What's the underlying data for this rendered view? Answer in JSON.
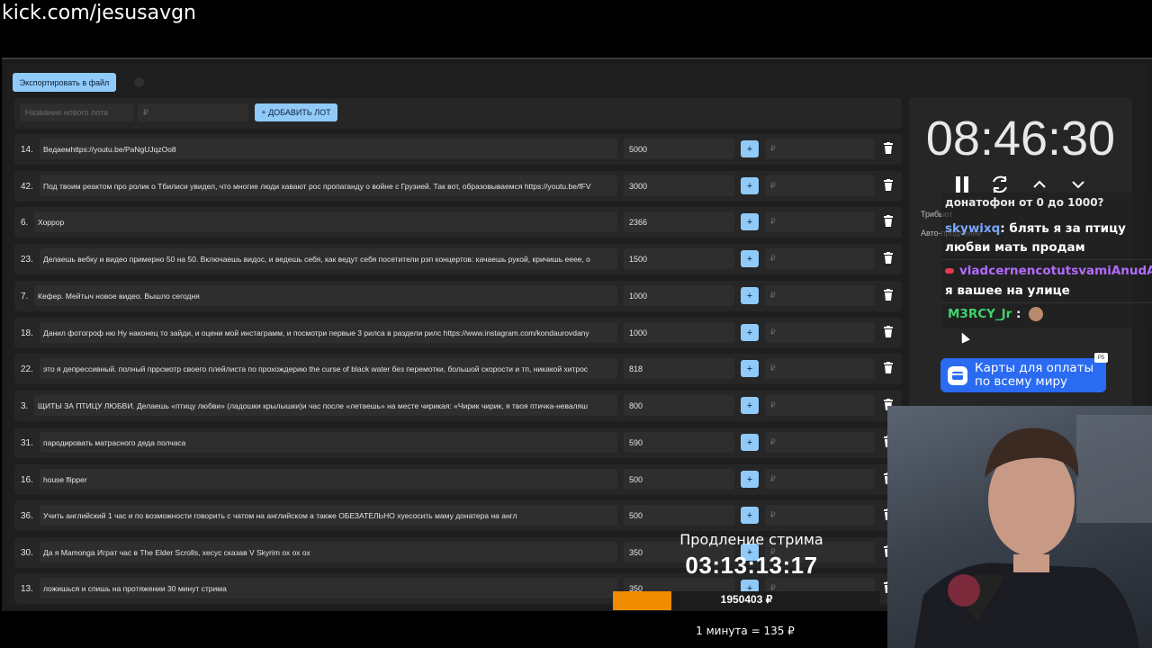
{
  "browser": {
    "url": "kick.com/jesusavgn"
  },
  "toolbar": {
    "export_label": "Экспортировать в файл"
  },
  "add_lot": {
    "name_placeholder": "Название нового лота",
    "amount_placeholder": "₽",
    "add_label": "+ ДОБАВИТЬ ЛОТ"
  },
  "lots": [
    {
      "num": "14.",
      "name": "Ведаемhttps://youtu.be/PaNgUJqzOo8",
      "amount": "5000",
      "plus": "+",
      "rub": "₽"
    },
    {
      "num": "42.",
      "name": "Под твоим реактом про ролик о Тбилиси увидел, что многие люди хавают рос пропаганду о войне с Грузией. Так вот, образовываемся https://youtu.be/fFV",
      "amount": "3000",
      "plus": "+",
      "rub": "₽"
    },
    {
      "num": "6.",
      "name": "Хоррор",
      "amount": "2366",
      "plus": "+",
      "rub": "₽"
    },
    {
      "num": "23.",
      "name": "Делаешь вебку и видео примерно 50 на 50. Включаешь видос, и ведешь себя, как ведут себя посетители рэп концертов: качаешь рукой, кричишь ееее, о",
      "amount": "1500",
      "plus": "+",
      "rub": "₽"
    },
    {
      "num": "7.",
      "name": "Кефер. Мейтыч новое видео. Вышло сегодня",
      "amount": "1000",
      "plus": "+",
      "rub": "₽"
    },
    {
      "num": "18.",
      "name": "Данил фотогроф ню Ну наконец то зайди, и оцени мой инстаграмм, и посмотри первые 3 рилса в раздели рилс https://www.instagram.com/kondaurovdany",
      "amount": "1000",
      "plus": "+",
      "rub": "₽"
    },
    {
      "num": "22.",
      "name": "это я депрессивный. полный пррсмотр своего плейлиста по прохождерию the curse of black water без перемотки, большой скорости и тп, никакой хитрос",
      "amount": "818",
      "plus": "+",
      "rub": "₽"
    },
    {
      "num": "3.",
      "name": "ЩИТЫ ЗА ПТИЦУ ЛЮБВИ. Делаешь «птицу любви» (ладошки крылышки)и час после «летаешь» на месте чирикая: «Чирик чирик, я твоя птичка-неваляш",
      "amount": "800",
      "plus": "+",
      "rub": "₽"
    },
    {
      "num": "31.",
      "name": "пародировать матрасного деда полчаса",
      "amount": "590",
      "plus": "+",
      "rub": "₽"
    },
    {
      "num": "16.",
      "name": "house flipper",
      "amount": "500",
      "plus": "+",
      "rub": "₽"
    },
    {
      "num": "36.",
      "name": "Учить английский 1 час и по возможности говорить с чатом на английском а также ОБЕЗАТЕЛЬНО хуесосить маму донатера на англ",
      "amount": "500",
      "plus": "+",
      "rub": "₽"
    },
    {
      "num": "30.",
      "name": "Да я Mamonga Играт час в The Elder Scrolls, хесус сказав V Skyrim ох ох ох",
      "amount": "350",
      "plus": "+",
      "rub": "₽"
    },
    {
      "num": "13.",
      "name": "ложишься и спишь на протяжении 30 минут стрима",
      "amount": "350",
      "plus": "+",
      "rub": "₽"
    }
  ],
  "timer": {
    "value": "08:46:30"
  },
  "side": {
    "tribute_label": "Трибьют",
    "auto_label": "Авто-продление"
  },
  "chat": {
    "partial_line": "донатофон от 0 до 1000?",
    "messages": [
      {
        "user": "skywixq",
        "user_color": "#7aa7ff",
        "text": ": блять я за птицу",
        "text2": "любви мать продам"
      },
      {
        "user": "vladcernencotutsvamiAnudA",
        "user_color": "#b36bff",
        "text": " :",
        "text2": "я вашее на улице"
      },
      {
        "user": "M3RCY_Jr",
        "user_color": "#3fd36b",
        "text": " :",
        "text2": ""
      }
    ]
  },
  "ad": {
    "line1": "Карты для оплаты",
    "line2": "по всему миру",
    "badge": "Р5"
  },
  "stream_ext": {
    "title": "Продление стрима",
    "timer": "03:13:13:17",
    "progress_fraction": 0.22,
    "progress_text": "1950403 ₽",
    "rate": "1 минута = 135 ₽"
  },
  "colors": {
    "accent": "#90caf9",
    "progress": "#f08c00",
    "ad": "#2a6bf2"
  }
}
